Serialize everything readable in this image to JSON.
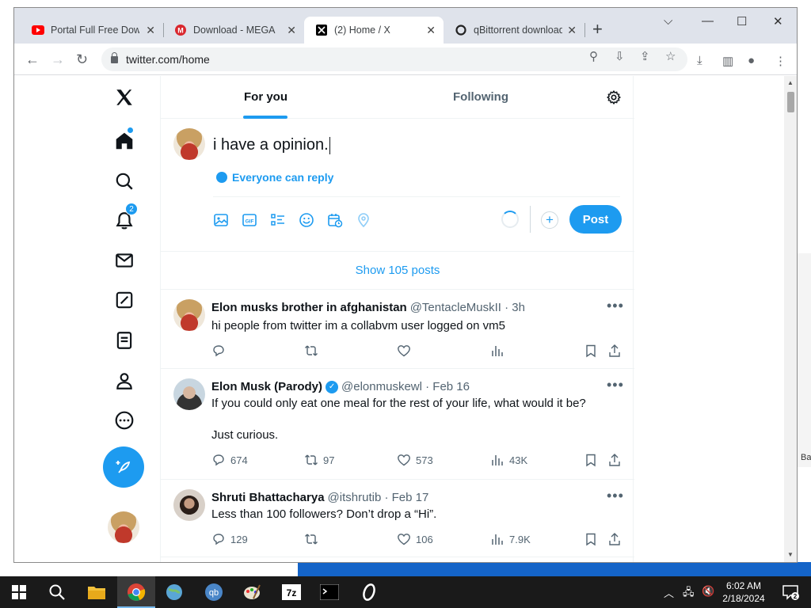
{
  "browser": {
    "tabs": [
      {
        "title": "Portal Full Free Down",
        "icon": "youtube-icon",
        "active": false
      },
      {
        "title": "Download - MEGA",
        "icon": "mega-icon",
        "active": false
      },
      {
        "title": "(2) Home / X",
        "icon": "x-icon",
        "active": true
      },
      {
        "title": "qBittorrent download",
        "icon": "qbittorrent-site-icon",
        "active": false
      }
    ],
    "new_tab_label": "+",
    "url": "twitter.com/home"
  },
  "sidebar": {
    "notification_count": "2"
  },
  "timeline": {
    "tab_for_you": "For you",
    "tab_following": "Following",
    "composer": {
      "text": "i have a opinion.",
      "reply_setting": "Everyone can reply",
      "post_label": "Post"
    },
    "show_posts": "Show 105 posts",
    "tweets": [
      {
        "name": "Elon musks brother in afghanistan",
        "handle": "@TentacleMuskII · 3h",
        "text": "hi people from twitter im a collabvm user logged on vm5",
        "replies": "",
        "reposts": "",
        "likes": "",
        "views": "",
        "verified": false
      },
      {
        "name": "Elon Musk (Parody)",
        "handle": "@elonmuskewl · Feb 16",
        "text": "If you could only eat one meal for the rest of your life, what would it be?",
        "text2": "Just curious.",
        "replies": "674",
        "reposts": "97",
        "likes": "573",
        "views": "43K",
        "verified": true
      },
      {
        "name": "Shruti Bhattacharya",
        "handle": "@itshrutib · Feb 17",
        "text": "Less than 100 followers? Don’t drop a “Hi”.",
        "replies": "129",
        "reposts": "",
        "likes": "106",
        "views": "7.9K",
        "verified": false
      }
    ]
  },
  "behind_window": {
    "text": "Ba"
  },
  "taskbar": {
    "time": "6:02 AM",
    "date": "2/18/2024",
    "notification_count": "2"
  },
  "colors": {
    "accent": "#1d9bf0",
    "text": "#0f1419",
    "muted": "#536471"
  }
}
